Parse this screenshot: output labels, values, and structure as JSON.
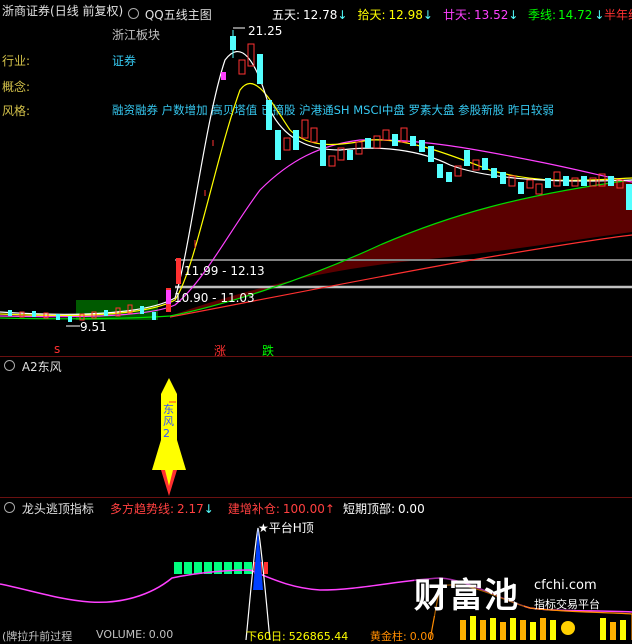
{
  "header": {
    "stock": "浙商证券",
    "mode": "(日线 前复权)",
    "indicator": "QQ五线主图",
    "ma": [
      {
        "label": "五天:",
        "value": "12.78",
        "arrow": "↓",
        "color": "#ffffff"
      },
      {
        "label": "拾天:",
        "value": "12.98",
        "arrow": "↓",
        "color": "#ffff00"
      },
      {
        "label": "廿天:",
        "value": "13.52",
        "arrow": "↓",
        "color": "#ff40ff"
      },
      {
        "label": "季线:",
        "value": "14.72",
        "arrow": "↓",
        "color": "#00ff00"
      },
      {
        "label": "半年线",
        "value": "",
        "arrow": "",
        "color": "#ff3030"
      }
    ]
  },
  "info": {
    "sector_value": "浙江板块",
    "industry_label": "行业:",
    "industry_value": "证券",
    "concept_label": "概念:",
    "concept_value": "",
    "style_label": "风格:",
    "style_value": "融资融券 户数增加 高贝塔值 已摘股 沪港通SH MSCI中盘 罗素大盘 参股新股 昨日较弱"
  },
  "price_labels": {
    "high": "21.25",
    "low": "9.51",
    "band1": "11.99 - 12.13",
    "band2": "10.90 - 11.03",
    "zhang": "涨",
    "die": "跌",
    "s_marker": "s"
  },
  "panel2": {
    "title": "A2东风",
    "rocket_text": "东风2"
  },
  "panel3": {
    "title": "龙头逃顶指标",
    "items": [
      {
        "label": "多方趋势线:",
        "value": "2.17",
        "arrow": "↓",
        "color": "#ff4040"
      },
      {
        "label": "建增补仓:",
        "value": "100.00",
        "arrow": "↑",
        "color": "#ff4040"
      },
      {
        "label": "短期顶部:",
        "value": "0.00",
        "arrow": "",
        "color": "#ffffff"
      }
    ],
    "platform_label": "平台H顶"
  },
  "footer": {
    "left": "(牌拉升前过程",
    "volume_label": "VOLUME:",
    "volume_value": "0.00",
    "ma60_label": "下60日:",
    "ma60_value": "526865.44",
    "gold_label": "黄金柱:",
    "gold_value": "0.00"
  },
  "watermark": {
    "brand": "财富池",
    "site": "cfchi.com",
    "slogan": "指标交易平台"
  },
  "colors": {
    "up": "#ff3232",
    "down": "#54ffff",
    "fill_dark": "#5a0000",
    "divider": "#6a1010"
  }
}
